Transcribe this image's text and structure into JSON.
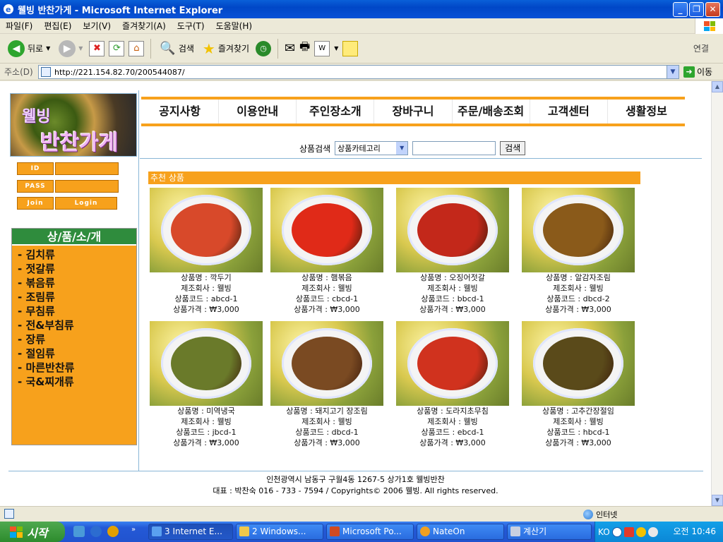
{
  "window": {
    "title": "웰빙 반찬가게 - Microsoft Internet Explorer"
  },
  "menubar": [
    "파일(F)",
    "편집(E)",
    "보기(V)",
    "즐겨찾기(A)",
    "도구(T)",
    "도움말(H)"
  ],
  "toolbar": {
    "back": "뒤로",
    "search": "검색",
    "favorites": "즐겨찾기",
    "link": "연결"
  },
  "address": {
    "label": "주소(D)",
    "url": "http://221.154.82.70/200544087/",
    "go": "이동"
  },
  "site": {
    "logo_line1": "웰빙",
    "logo_line2": "반찬가게",
    "nav": [
      "공지사항",
      "이용안내",
      "주인장소개",
      "장바구니",
      "주문/배송조회",
      "고객센터",
      "생활정보"
    ],
    "search": {
      "label": "상품검색",
      "select": "상품카테고리",
      "button": "검색"
    },
    "login": {
      "id": "ID",
      "pass": "PASS",
      "join": "Join",
      "login": "Login"
    },
    "categories_title": "상/품/소/개",
    "categories": [
      "- 김치류",
      "- 젓갈류",
      "- 볶음류",
      "- 조림류",
      "- 무침류",
      "- 전&부침류",
      "- 장류",
      "- 절임류",
      "- 마른반찬류",
      "- 국&찌개류"
    ],
    "recommended": "추천 상품",
    "products": [
      {
        "name": "상품명 : 깍두기",
        "maker": "제조회사 : 웰빙",
        "code": "상품코드 : abcd-1",
        "price": "상품가격 : ₩3,000",
        "color": "#d8492a"
      },
      {
        "name": "상품명 : 햄볶음",
        "maker": "제조회사 : 웰빙",
        "code": "상품코드 : cbcd-1",
        "price": "상품가격 : ₩3,000",
        "color": "#e02a18"
      },
      {
        "name": "상품명 : 오징어젓갈",
        "maker": "제조회사 : 웰빙",
        "code": "상품코드 : bbcd-1",
        "price": "상품가격 : ₩3,000",
        "color": "#c3281a"
      },
      {
        "name": "상품명 : 알감자조림",
        "maker": "제조회사 : 웰빙",
        "code": "상품코드 : dbcd-2",
        "price": "상품가격 : ₩3,000",
        "color": "#8a5a1a"
      },
      {
        "name": "상품명 : 미역냉국",
        "maker": "제조회사 : 웰빙",
        "code": "상품코드 : jbcd-1",
        "price": "상품가격 : ₩3,000",
        "color": "#6a7a2a"
      },
      {
        "name": "상품명 : 돼지고기 장조림",
        "maker": "제조회사 : 웰빙",
        "code": "상품코드 : dbcd-1",
        "price": "상품가격 : ₩3,000",
        "color": "#7a4a22"
      },
      {
        "name": "상품명 : 도라지초무침",
        "maker": "제조회사 : 웰빙",
        "code": "상품코드 : ebcd-1",
        "price": "상품가격 : ₩3,000",
        "color": "#d0321e"
      },
      {
        "name": "상품명 : 고추간장절임",
        "maker": "제조회사 : 웰빙",
        "code": "상품코드 : hbcd-1",
        "price": "상품가격 : ₩3,000",
        "color": "#5a4a1a"
      }
    ],
    "footer_address": "인천광역시 남동구 구월4동 1267-5 상가1호 웰빙반찬",
    "footer_copy": "대표 : 박찬숙 016 - 733 - 7594 / Copyrights© 2006 웰빙. All rights reserved."
  },
  "statusbar": {
    "zone": "인터넷"
  },
  "taskbar": {
    "start": "시작",
    "tasks": [
      "3 Internet E...",
      "2 Windows...",
      "Microsoft Po...",
      "NateOn",
      "계산기"
    ],
    "lang": "KO",
    "clock": "오전 10:46"
  },
  "colors": {
    "accent": "#f7a11c",
    "category_header": "#2f8c3d",
    "xp_blue": "#0a52d6"
  }
}
